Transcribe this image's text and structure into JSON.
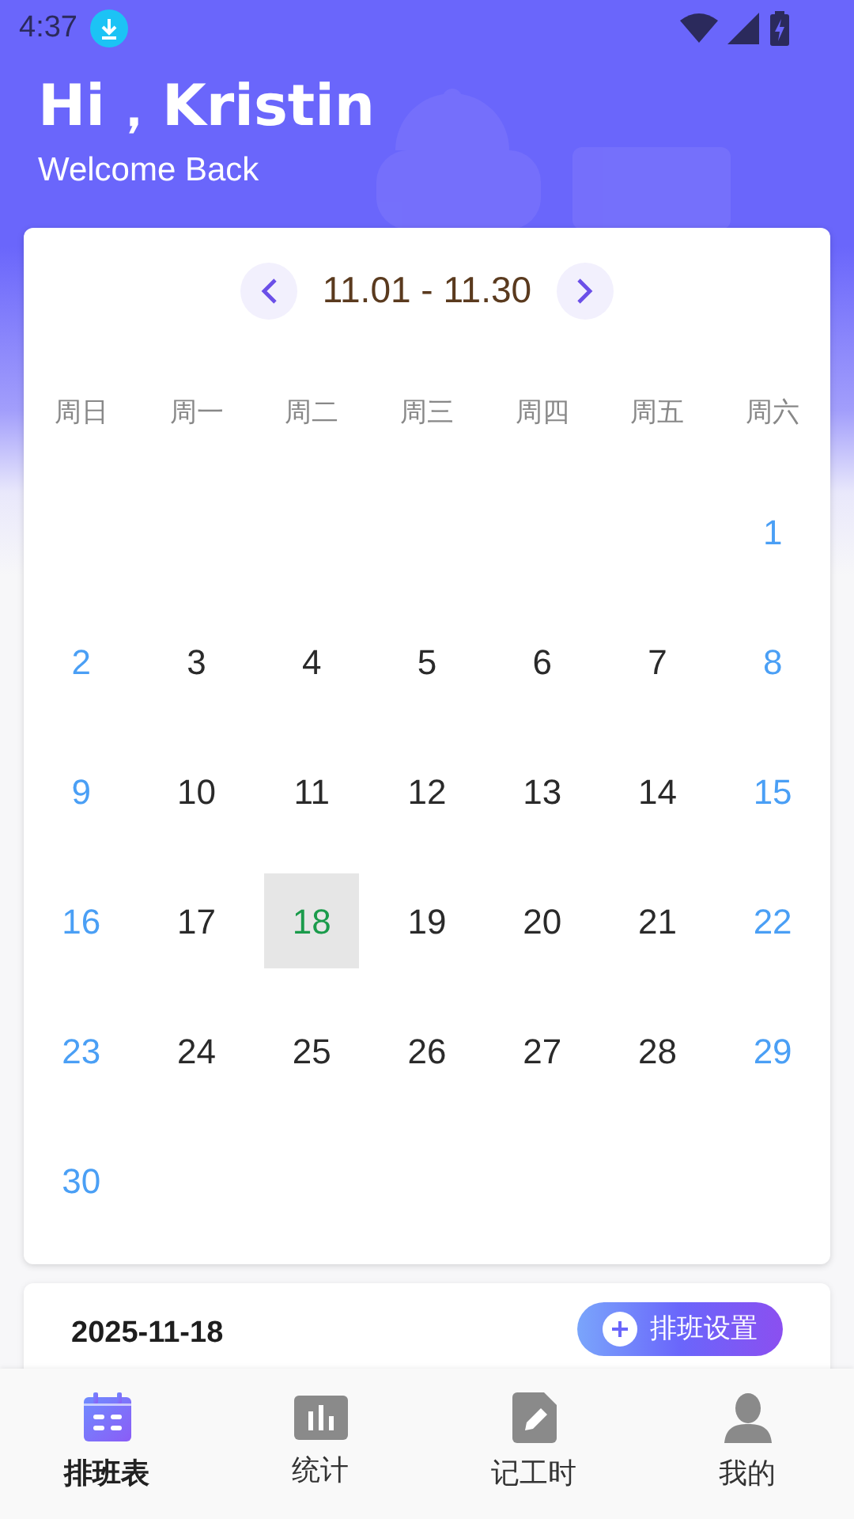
{
  "status_bar": {
    "time": "4:37"
  },
  "greeting": {
    "title": "Hi，Kristin",
    "subtitle": "Welcome Back"
  },
  "calendar": {
    "range": "11.01 - 11.30",
    "weekdays": [
      "周日",
      "周一",
      "周二",
      "周三",
      "周四",
      "周五",
      "周六"
    ],
    "weeks": [
      [
        {
          "kind": "blank"
        },
        {
          "kind": "blank"
        },
        {
          "kind": "blank"
        },
        {
          "kind": "blank"
        },
        {
          "kind": "blank"
        },
        {
          "kind": "blank"
        },
        {
          "kind": "day",
          "label": "1",
          "weekend": true,
          "selected": false
        }
      ],
      [
        {
          "label": "2",
          "weekend": true,
          "selected": false
        },
        {
          "label": "3",
          "weekend": false,
          "selected": false
        },
        {
          "label": "4",
          "weekend": false,
          "selected": false
        },
        {
          "label": "5",
          "weekend": false,
          "selected": false
        },
        {
          "label": "6",
          "weekend": false,
          "selected": false
        },
        {
          "label": "7",
          "weekend": false,
          "selected": false
        },
        {
          "label": "8",
          "weekend": true,
          "selected": false
        }
      ],
      [
        {
          "label": "9",
          "weekend": true,
          "selected": false
        },
        {
          "label": "10",
          "weekend": false,
          "selected": false
        },
        {
          "label": "11",
          "weekend": false,
          "selected": false
        },
        {
          "label": "12",
          "weekend": false,
          "selected": false
        },
        {
          "label": "13",
          "weekend": false,
          "selected": false
        },
        {
          "label": "14",
          "weekend": false,
          "selected": false
        },
        {
          "label": "15",
          "weekend": true,
          "selected": false
        }
      ],
      [
        {
          "label": "16",
          "weekend": true,
          "selected": false
        },
        {
          "label": "17",
          "weekend": false,
          "selected": false
        },
        {
          "label": "18",
          "weekend": false,
          "selected": true
        },
        {
          "label": "19",
          "weekend": false,
          "selected": false
        },
        {
          "label": "20",
          "weekend": false,
          "selected": false
        },
        {
          "label": "21",
          "weekend": false,
          "selected": false
        },
        {
          "label": "22",
          "weekend": true,
          "selected": false
        }
      ],
      [
        {
          "label": "23",
          "weekend": true,
          "selected": false
        },
        {
          "label": "24",
          "weekend": false,
          "selected": false
        },
        {
          "label": "25",
          "weekend": false,
          "selected": false
        },
        {
          "label": "26",
          "weekend": false,
          "selected": false
        },
        {
          "label": "27",
          "weekend": false,
          "selected": false
        },
        {
          "label": "28",
          "weekend": false,
          "selected": false
        },
        {
          "label": "29",
          "weekend": true,
          "selected": false
        }
      ],
      [
        {
          "kind": "day",
          "label": "30",
          "weekend": true,
          "selected": false
        },
        {
          "kind": "blank"
        },
        {
          "kind": "blank"
        },
        {
          "kind": "blank"
        },
        {
          "kind": "blank"
        },
        {
          "kind": "blank"
        },
        {
          "kind": "blank"
        }
      ]
    ]
  },
  "detail": {
    "date": "2025-11-18",
    "button": "排班设置"
  },
  "nav": [
    {
      "label": "排班表",
      "kind": "calendar",
      "selected": true
    },
    {
      "label": "统计",
      "kind": "chart",
      "selected": false
    },
    {
      "label": "记工时",
      "kind": "note",
      "selected": false
    },
    {
      "label": "我的",
      "kind": "person",
      "selected": false
    }
  ]
}
